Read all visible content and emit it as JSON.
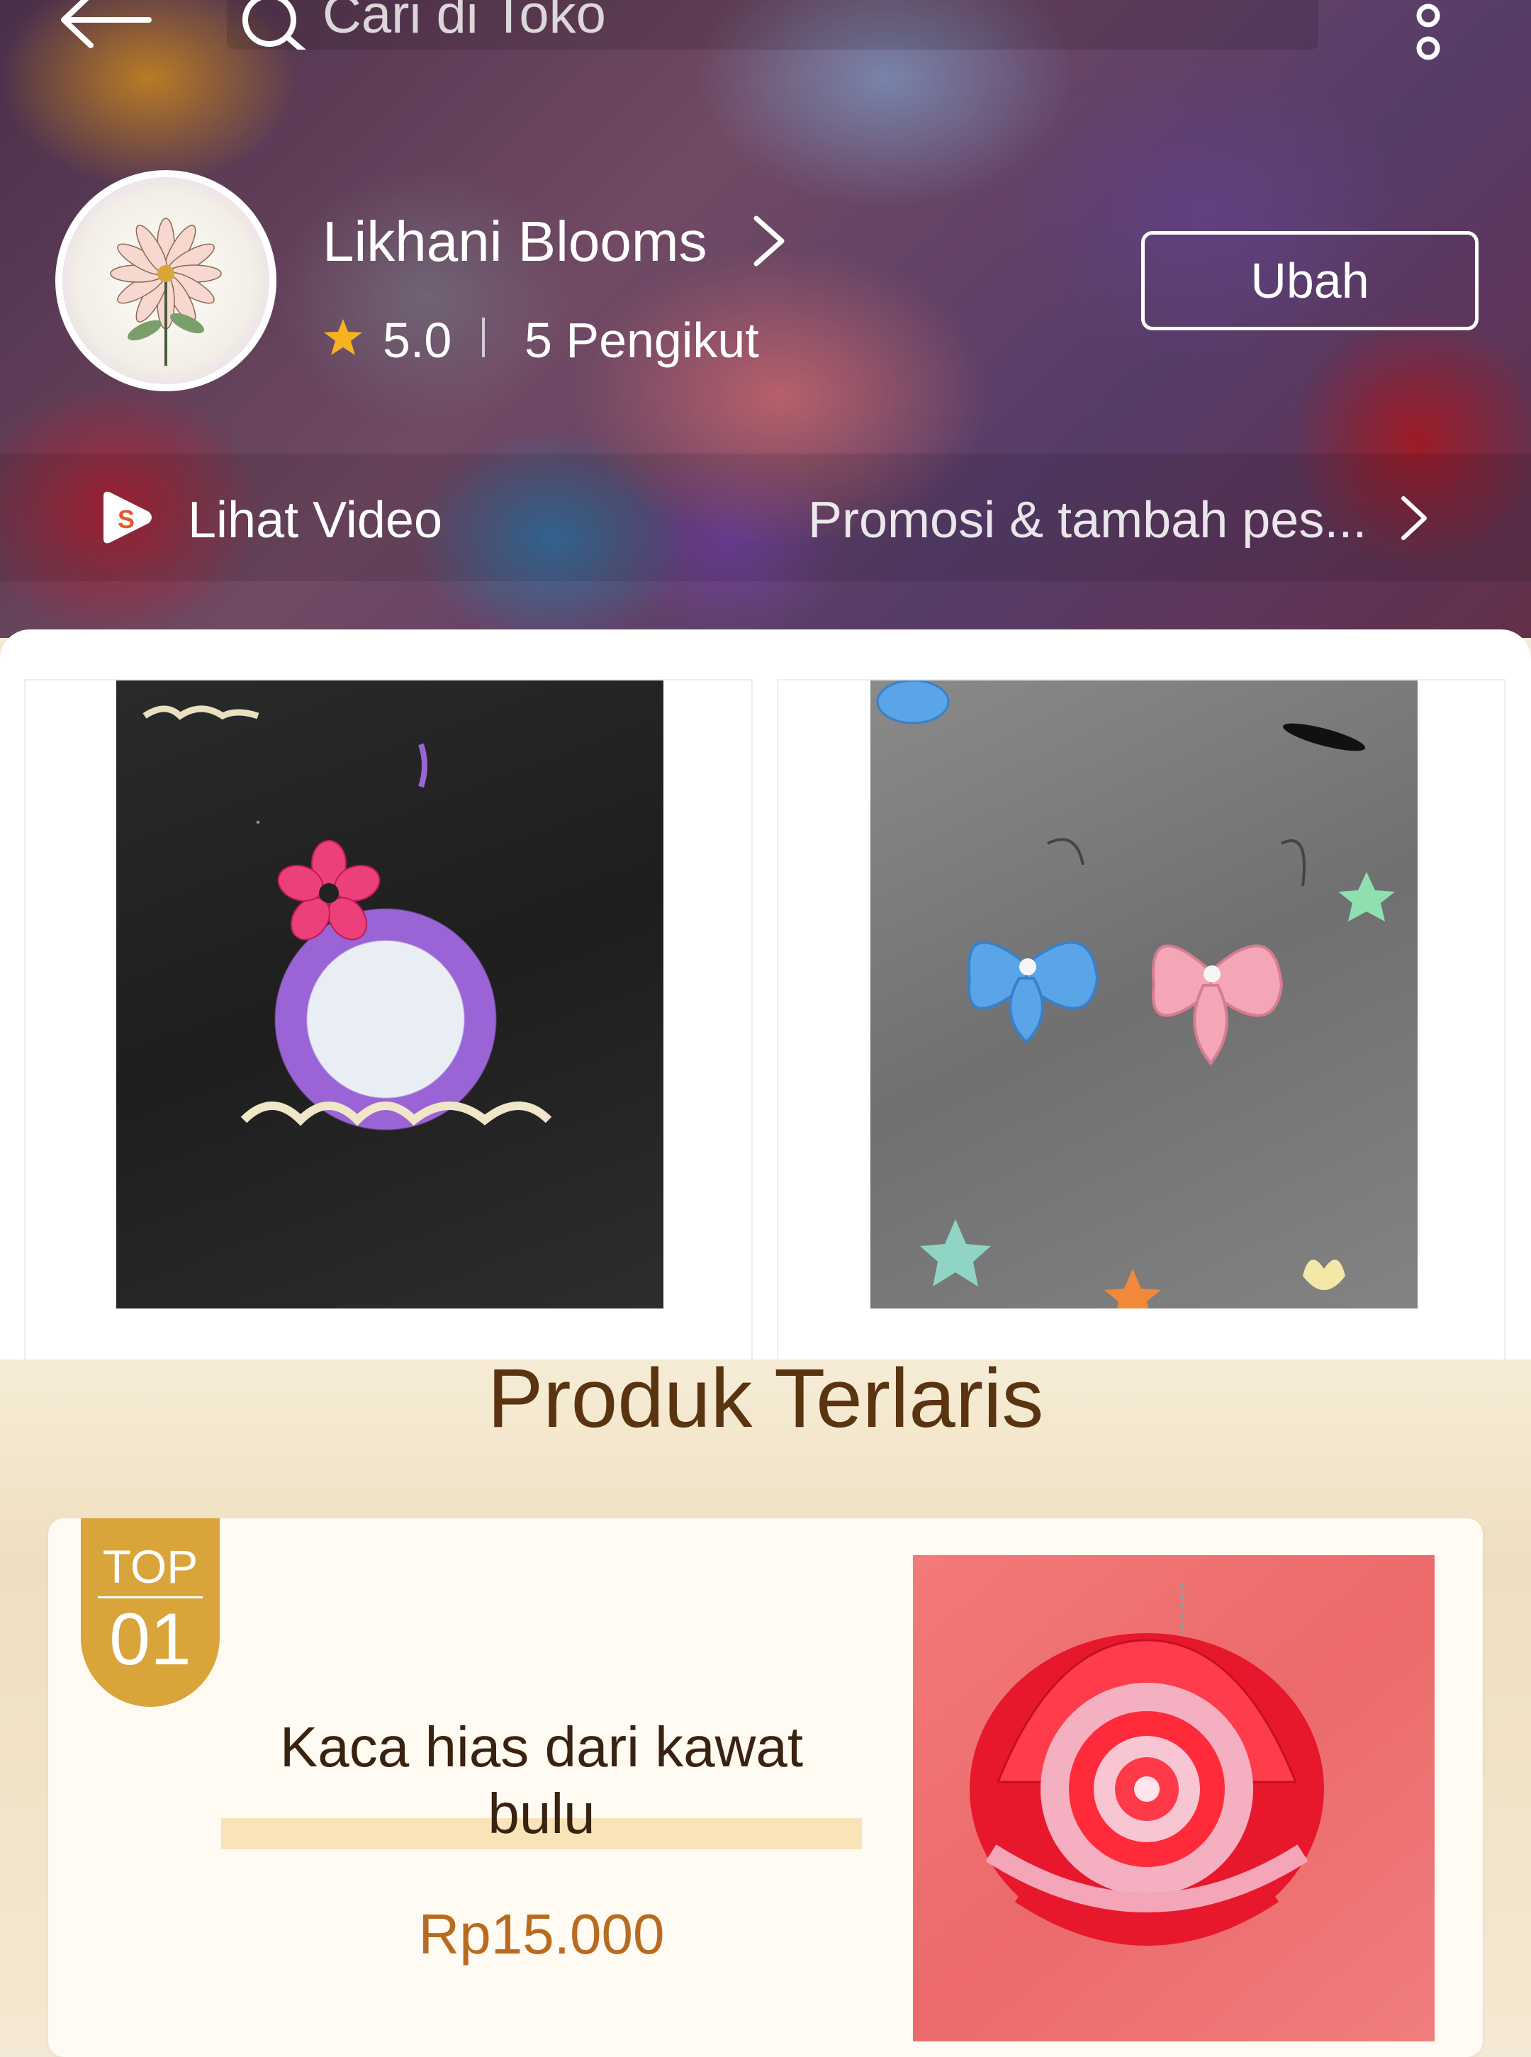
{
  "header": {
    "search_placeholder": "Cari di Toko"
  },
  "shop": {
    "name": "Likhani Blooms",
    "rating": "5.0",
    "followers": "5 Pengikut",
    "edit_label": "Ubah",
    "video_label": "Lihat Video",
    "promo_label": "Promosi & tambah pes..."
  },
  "bestsellers": {
    "title": "Produk Terlaris",
    "items": [
      {
        "rank_label": "TOP",
        "rank": "01",
        "name": "Kaca hias dari kawat bulu",
        "price": "Rp15.000"
      }
    ]
  },
  "colors": {
    "accent": "#d9a53a",
    "price": "#b86b20",
    "title": "#5a3410"
  }
}
